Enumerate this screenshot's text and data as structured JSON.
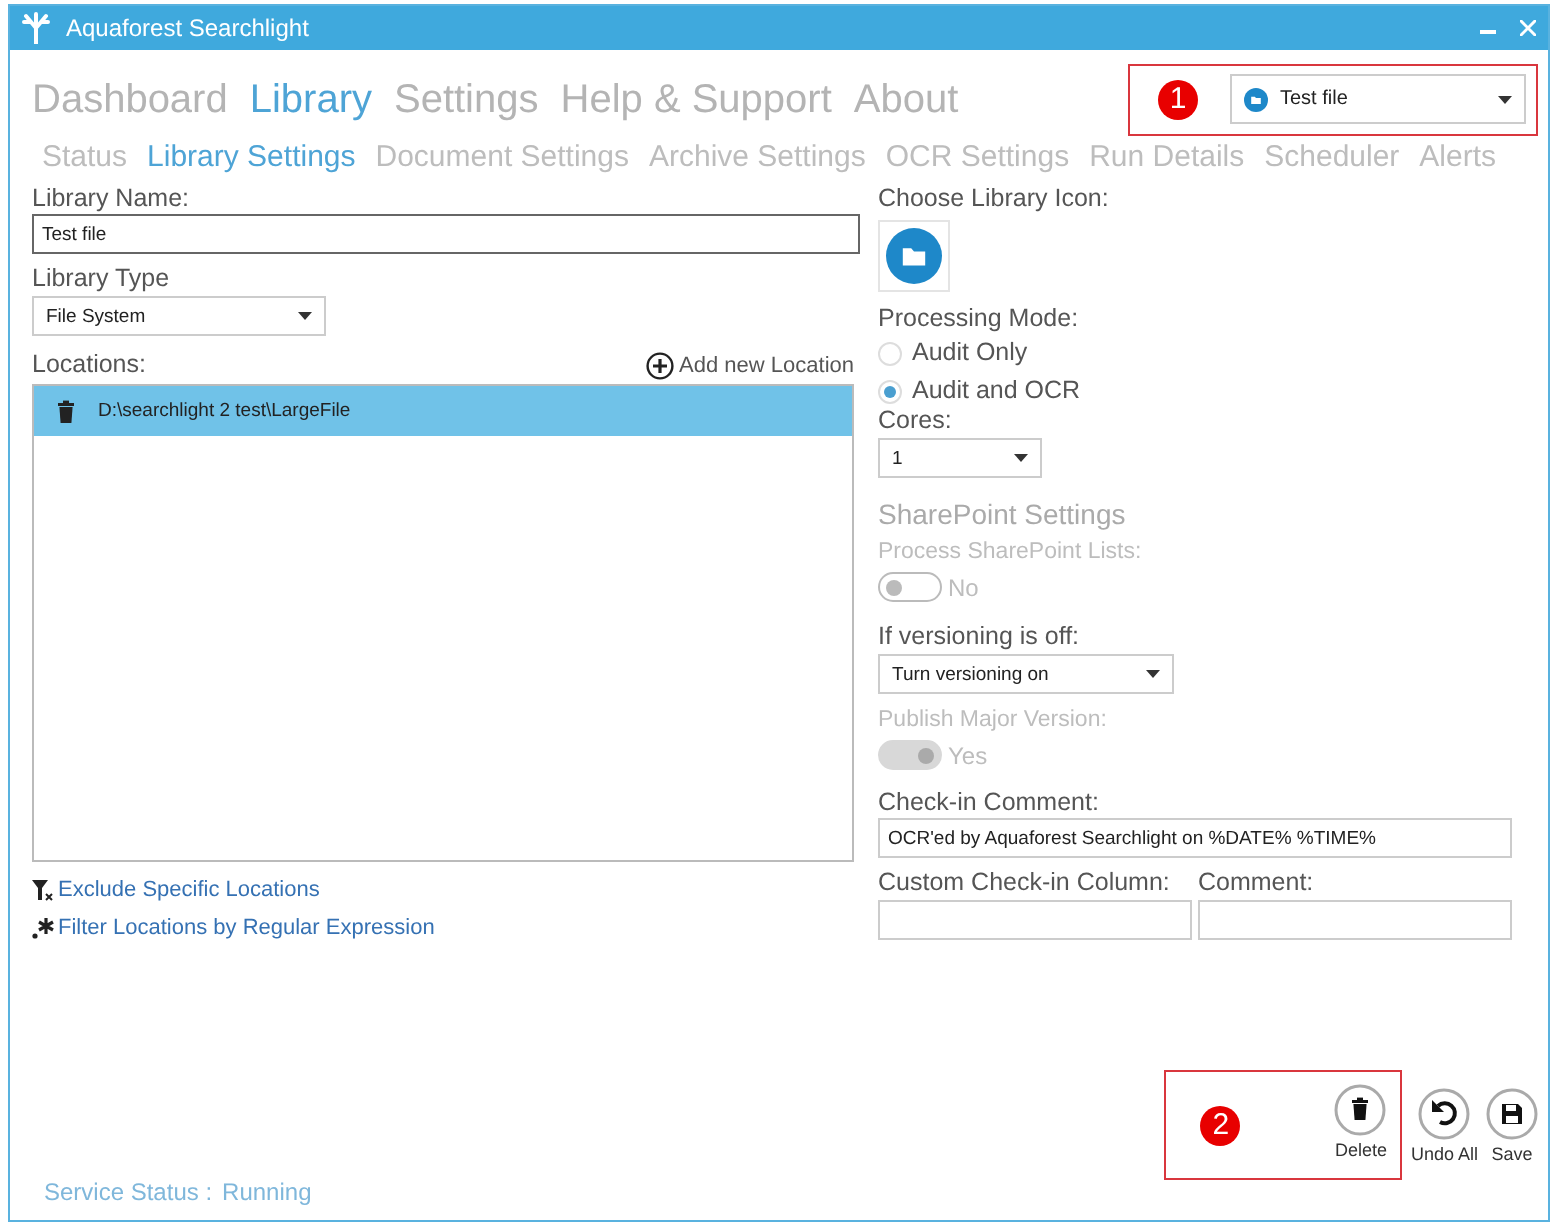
{
  "window": {
    "title": "Aquaforest Searchlight"
  },
  "main_nav": [
    {
      "label": "Dashboard",
      "selected": false
    },
    {
      "label": "Library",
      "selected": true
    },
    {
      "label": "Settings",
      "selected": false
    },
    {
      "label": "Help & Support",
      "selected": false
    },
    {
      "label": "About",
      "selected": false
    }
  ],
  "callouts": [
    {
      "number": "1"
    },
    {
      "number": "2"
    }
  ],
  "library_picker": {
    "value": "Test file"
  },
  "sub_nav": [
    {
      "label": "Status",
      "selected": false
    },
    {
      "label": "Library Settings",
      "selected": true
    },
    {
      "label": "Document Settings",
      "selected": false
    },
    {
      "label": "Archive Settings",
      "selected": false
    },
    {
      "label": "OCR Settings",
      "selected": false
    },
    {
      "label": "Run Details",
      "selected": false
    },
    {
      "label": "Scheduler",
      "selected": false
    },
    {
      "label": "Alerts",
      "selected": false
    }
  ],
  "library_name": {
    "label": "Library Name:",
    "value": "Test file"
  },
  "library_type": {
    "label": "Library Type",
    "value": "File System"
  },
  "locations": {
    "label": "Locations:",
    "add_label": "Add new Location",
    "items": [
      {
        "path": "D:\\searchlight 2 test\\LargeFile",
        "selected": true
      }
    ]
  },
  "links": [
    {
      "kind": "exclude",
      "label": "Exclude Specific Locations"
    },
    {
      "kind": "regex",
      "label": "Filter Locations by Regular Expression"
    }
  ],
  "library_icon": {
    "label": "Choose Library Icon:"
  },
  "processing_mode": {
    "label": "Processing Mode:",
    "options": [
      {
        "label": "Audit Only",
        "selected": false
      },
      {
        "label": "Audit and OCR",
        "selected": true
      }
    ]
  },
  "cores": {
    "label": "Cores:",
    "value": "1"
  },
  "sharepoint": {
    "title": "SharePoint Settings",
    "process_lists": {
      "label": "Process SharePoint Lists:",
      "on": false,
      "disabled": true,
      "state_text": "No"
    },
    "versioning": {
      "label": "If versioning is off:",
      "value": "Turn versioning on"
    },
    "publish_major": {
      "label": "Publish Major Version:",
      "on": true,
      "disabled": true,
      "state_text": "Yes"
    },
    "check_in_comment": {
      "label": "Check-in Comment:",
      "value": "OCR'ed by Aquaforest Searchlight on %DATE% %TIME%"
    },
    "custom_column": {
      "label": "Custom Check-in Column:"
    },
    "comment": {
      "label": "Comment:"
    }
  },
  "actions": [
    {
      "kind": "delete",
      "label": "Delete"
    },
    {
      "kind": "undo",
      "label": "Undo All"
    },
    {
      "kind": "save",
      "label": "Save"
    }
  ],
  "status_bar": {
    "label": "Service Status :",
    "value": "Running"
  }
}
